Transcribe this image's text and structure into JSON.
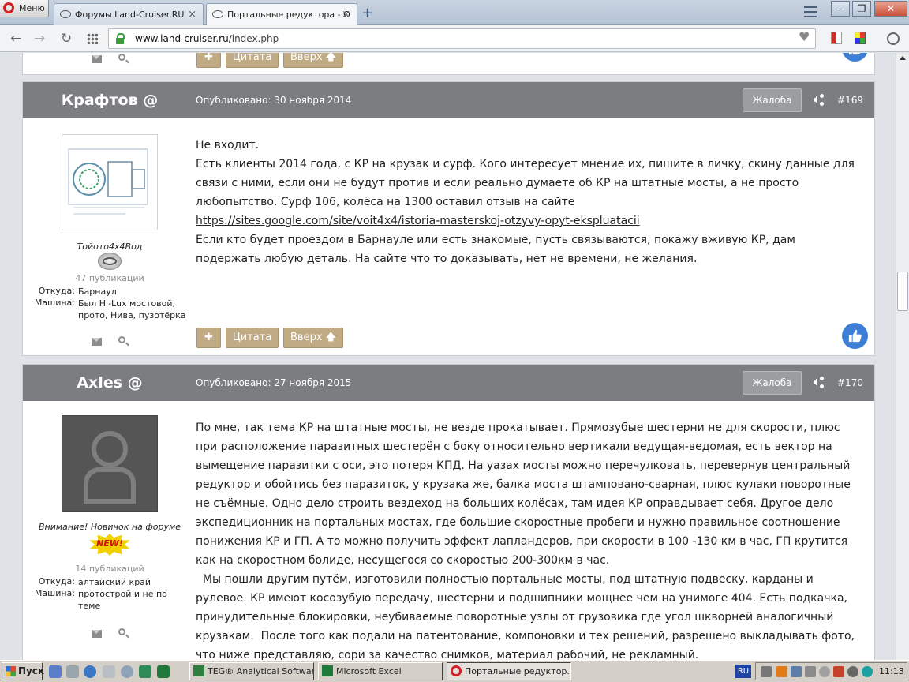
{
  "browser": {
    "menu_label": "Меню",
    "tabs": [
      {
        "title": "Форумы Land-Cruiser.RU",
        "active": false
      },
      {
        "title": "Портальные редуктора - О",
        "active": true
      }
    ],
    "url_host": "www.land-cruiser.ru",
    "url_path": "/index.php"
  },
  "buttons": {
    "plus": "✚",
    "quote": "Цитата",
    "up": "Вверх 🡅",
    "report": "Жалоба"
  },
  "posts": [
    {
      "author": "Крафтов @",
      "published": "Опубликовано: 30 ноября 2014",
      "number": "#169",
      "user_title": "Тойото4х4Вод",
      "post_count": "47 публикаций",
      "from_label": "Откуда:",
      "from_value": "Барнаул",
      "car_label": "Машина:",
      "car_value": "Был Hi-Lux мостовой, прото, Нива, пузотёрка",
      "body": [
        "Не входит.",
        "Есть клиенты 2014 года, с КР на крузак и сурф. Кого интересует мнение их, пишите в личку, скину данные для связи с ними, если они не будут против и если реально думаете об КР на штатные мосты, а не просто любопытство. Сурф 106, колёса на 1300 оставил отзыв на сайте",
        "https://sites.google.com/site/voit4x4/istoria-masterskoj-otzyvy-opyt-ekspluatacii",
        "Если кто будет проездом в Барнауле или есть знакомые, пусть связываются, покажу вживую КР, дам подержать любую деталь. На сайте что то доказывать, нет не времени, не желания."
      ]
    },
    {
      "author": "Axles @",
      "published": "Опубликовано: 27 ноября 2015",
      "number": "#170",
      "user_title": "Внимание! Новичок на форуме",
      "badge": "NEW!",
      "post_count": "14 публикаций",
      "from_label": "Откуда:",
      "from_value": "алтайский край",
      "car_label": "Машина:",
      "car_value": "протострой и не по теме",
      "body": [
        "По мне, так тема КР на штатные мосты, не везде прокатывает. Прямозубые шестерни не для скорости, плюс при расположение паразитных шестерён с боку относительно вертикали ведущая-ведомая, есть вектор на вымещение паразитки с оси, это потеря КПД. На уазах мосты можно перечулковать, перевернув центральный редуктор и обойтись без паразиток, у крузака же, балка моста штамповано-сварная, плюс кулаки поворотные не съёмные. Одно дело строить вездеход на больших колёсах, там идея КР оправдывает себя. Другое дело экспедиционник на портальных мостах, где большие скоростные пробеги и нужно правильное соотношение понижения КР и ГП. А то можно получить эффект лапландеров, при скорости в 100 -130 км в час, ГП крутится как на скоростном болиде, несущегося со скоростью 200-300км в час.",
        "  Мы пошли другим путём, изготовили полностью портальные мосты, под штатную подвеску, карданы и рулевое. КР имеют косозубую передачу, шестерни и подшипники мощнее чем на унимоге 404. Есть подкачка, принудительные блокировки, неубиваемые поворотные узлы от грузовика где угол шкворней аналогичный крузакам.  После того как подали на патентование, компоновки и тех решений, разрешено выкладывать фото, что ниже представляю, сори за качество снимков, материал рабочий, не рекламный."
      ]
    }
  ],
  "taskbar": {
    "start_label": "Пуск",
    "tasks": [
      {
        "label": "TEG® Analytical Softwar..."
      },
      {
        "label": "Microsoft Excel"
      },
      {
        "label": "Портальные редуктор..."
      }
    ],
    "language": "RU",
    "clock": "11:13"
  },
  "colors": {
    "post_header": "#7b7d80",
    "post_button": "#c1ab85",
    "like_button": "#3d7ed6",
    "secure_lock": "#3c9b3c"
  }
}
